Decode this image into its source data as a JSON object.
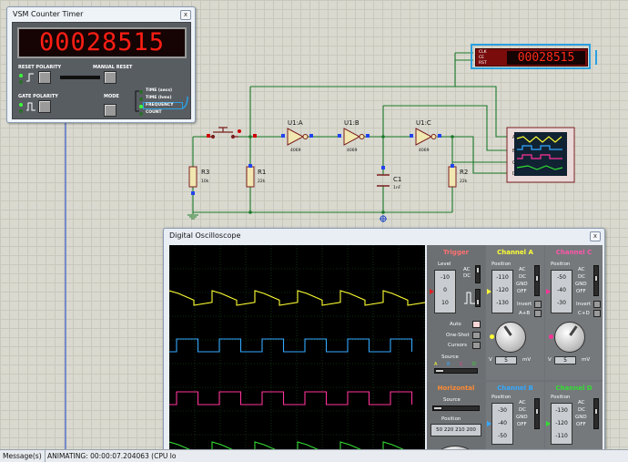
{
  "counter_timer": {
    "title": "VSM Counter Timer",
    "close": "x",
    "display": "00028515",
    "reset_polarity_label": "RESET POLARITY",
    "manual_reset_label": "MANUAL RESET",
    "gate_polarity_label": "GATE POLARITY",
    "mode_label": "MODE",
    "modes": [
      "TIME (secs)",
      "TIME (hms)",
      "FREQUENCY",
      "COUNT"
    ],
    "selected_mode": "FREQUENCY",
    "led_on_color": "#3cff3c"
  },
  "schematic": {
    "small_counter": {
      "display": "00028515",
      "pins": [
        "CLK",
        "CE",
        "RST"
      ]
    },
    "components": {
      "r3": {
        "name": "R3",
        "value": "10k"
      },
      "r1": {
        "name": "R1",
        "value": "22k"
      },
      "r2": {
        "name": "R2",
        "value": "22k"
      },
      "c1": {
        "name": "C1",
        "value": "1nF"
      },
      "u1a": {
        "name": "U1:A",
        "part": "4069"
      },
      "u1b": {
        "name": "U1:B",
        "part": "4069"
      },
      "u1c": {
        "name": "U1:C",
        "part": "4069"
      }
    },
    "scope_pins": [
      "A",
      "B",
      "C",
      "D"
    ]
  },
  "oscilloscope": {
    "title": "Digital Oscilloscope",
    "close": "x",
    "trigger": {
      "title": "Trigger",
      "level_label": "Level",
      "level_ticks": [
        "-10",
        "0",
        "10"
      ],
      "coupling": [
        "AC",
        "DC"
      ],
      "auto": "Auto",
      "one_shot": "One-Shot",
      "cursors": "Cursors",
      "source_label": "Source",
      "source_channels": [
        "A",
        "B",
        "C",
        "D"
      ]
    },
    "channel_a": {
      "title": "Channel A",
      "position_label": "Position",
      "position_values": [
        "-110",
        "-120",
        "-130"
      ],
      "coupling": [
        "AC",
        "DC",
        "GND",
        "OFF"
      ],
      "invert": "Invert",
      "sum": "A+B",
      "volts_value": "5",
      "volts_unit": "mV",
      "volts_prefix": "V"
    },
    "channel_c": {
      "title": "Channel C",
      "position_label": "Position",
      "position_values": [
        "-50",
        "-40",
        "-30"
      ],
      "coupling": [
        "AC",
        "DC",
        "GND",
        "OFF"
      ],
      "invert": "Invert",
      "sum": "C+D",
      "volts_value": "5",
      "volts_unit": "mV",
      "volts_prefix": "V"
    },
    "horizontal": {
      "title": "Horizontal",
      "source_label": "Source",
      "position_label": "Position",
      "position_values": [
        "50",
        "220",
        "210",
        "200"
      ]
    },
    "channel_b": {
      "title": "Channel B",
      "position_label": "Position",
      "position_values": [
        "-30",
        "-40",
        "-50"
      ],
      "coupling": [
        "AC",
        "DC",
        "GND",
        "OFF"
      ]
    },
    "channel_d": {
      "title": "Channel D",
      "position_label": "Position",
      "position_values": [
        "-130",
        "-120",
        "-110"
      ],
      "coupling": [
        "AC",
        "DC",
        "GND",
        "OFF"
      ]
    },
    "trace_colors": {
      "a": "#ffff33",
      "b": "#33a9ff",
      "c": "#ff3399",
      "d": "#33dd33"
    }
  },
  "status_bar": {
    "messages_tab": "Message(s)",
    "animating": "ANIMATING: 00:00:07.204063 (CPU lo"
  }
}
